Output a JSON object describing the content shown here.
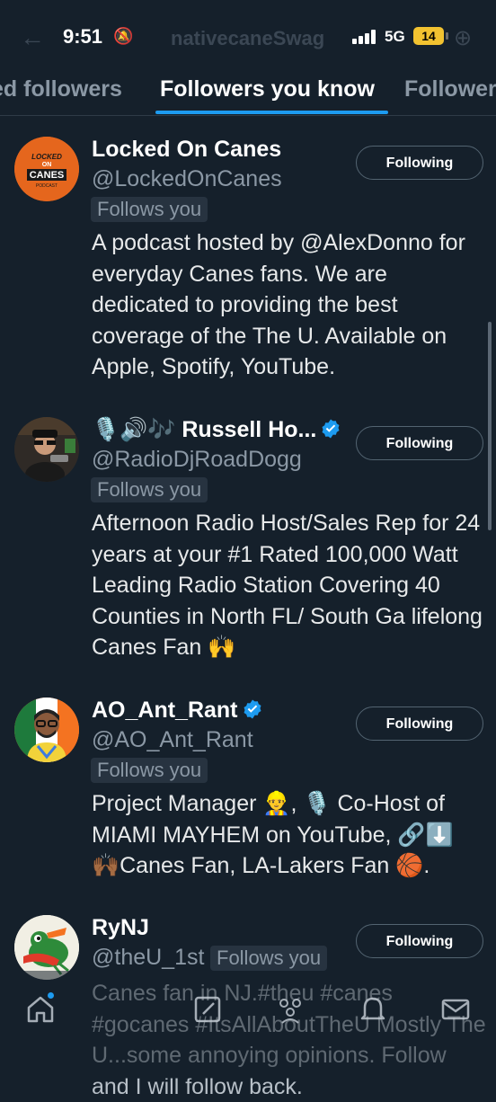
{
  "status_bar": {
    "time": "9:51",
    "network": "5G",
    "battery": "14",
    "background_title": "nativecaneSwag"
  },
  "tabs": [
    {
      "label": "ed followers"
    },
    {
      "label": "Followers you know"
    },
    {
      "label": "Follower"
    }
  ],
  "accent_color": "#1d9bf0",
  "users": [
    {
      "name": "Locked On Canes",
      "handle": "@LockedOnCanes",
      "follows_you": "Follows you",
      "button": "Following",
      "verified": false,
      "bio": "A podcast hosted by @AlexDonno for everyday Canes fans. We are dedicated to providing the best coverage of the The U. Available on Apple, Spotify, YouTube."
    },
    {
      "name": "🎙️🔊🎶 Russell Ho...",
      "handle": "@RadioDjRoadDogg",
      "follows_you": "Follows you",
      "button": "Following",
      "verified": true,
      "bio": "Afternoon Radio Host/Sales Rep for 24 years at your #1 Rated 100,000 Watt Leading Radio Station Covering 40 Counties in North FL/ South Ga lifelong Canes Fan 🙌"
    },
    {
      "name": "AO_Ant_Rant",
      "handle": "@AO_Ant_Rant",
      "follows_you": "Follows you",
      "button": "Following",
      "verified": true,
      "bio": "Project Manager 👷‍♂️, 🎙️ Co-Host of MIAMI MAYHEM on YouTube, 🔗⬇️ 🙌🏾Canes Fan, LA-Lakers Fan 🏀."
    },
    {
      "name": "RyNJ",
      "handle": "@theU_1st",
      "follows_you": "Follows you",
      "button": "Following",
      "verified": false,
      "bio": "Canes fan in NJ.#theu #canes #gocanes #ItsAllAboutTheU Mostly The U...some annoying opinions. Follow and I will follow back."
    }
  ],
  "avatar_logo": {
    "line1": "LOCKED",
    "line2": "ON",
    "line3": "CANES",
    "line4": "PODCAST"
  },
  "icons": [
    "home-icon",
    "compose-icon",
    "communities-icon",
    "notifications-icon",
    "messages-icon"
  ]
}
